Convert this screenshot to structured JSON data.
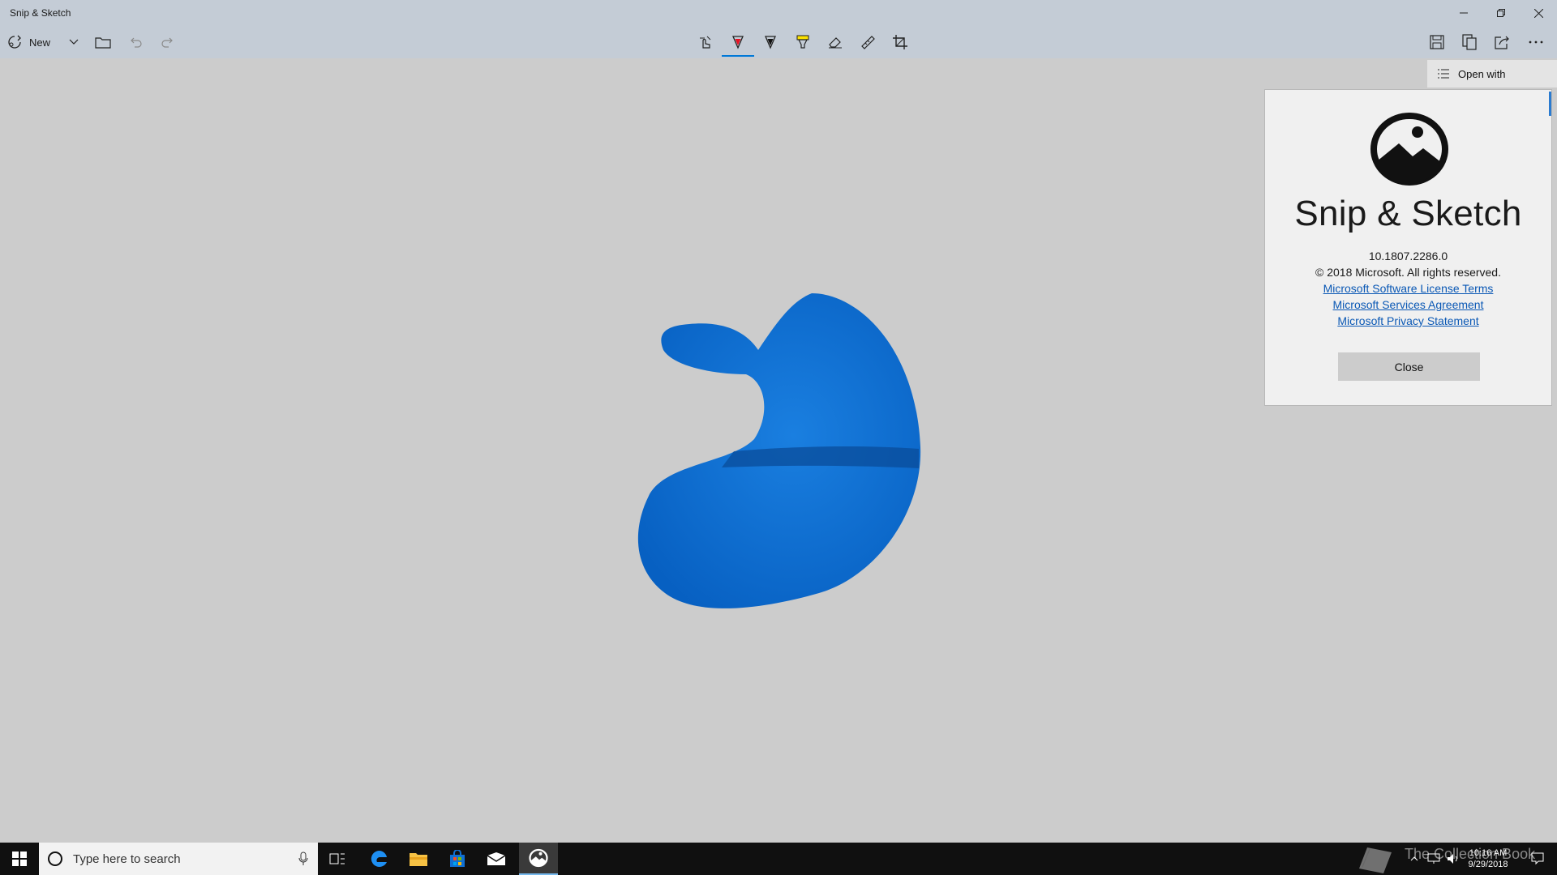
{
  "window": {
    "title": "Snip & Sketch"
  },
  "toolbar": {
    "new_label": "New",
    "icons": [
      "new-snip-icon",
      "chevron-down-icon",
      "open-folder-icon",
      "undo-icon",
      "redo-icon",
      "touch-writing-icon",
      "ballpoint-pen-icon",
      "pencil-icon",
      "highlighter-icon",
      "eraser-icon",
      "ruler-icon",
      "crop-icon",
      "save-icon",
      "copy-icon",
      "share-icon",
      "more-icon"
    ]
  },
  "menu": {
    "open_with": "Open with"
  },
  "about": {
    "app_name": "Snip & Sketch",
    "version": "10.1807.2286.0",
    "copyright": "© 2018 Microsoft. All rights reserved.",
    "links": [
      "Microsoft Software License Terms",
      "Microsoft Services Agreement",
      "Microsoft Privacy Statement"
    ],
    "close_label": "Close"
  },
  "taskbar": {
    "search_placeholder": "Type here to search",
    "time": "10:16 AM",
    "date": "9/29/2018",
    "watermark": "The Collection Book"
  },
  "colors": {
    "accent": "#0078d7",
    "shape": "#0a6fd1",
    "pen_red": "#e81123",
    "highlighter": "#fce100"
  }
}
